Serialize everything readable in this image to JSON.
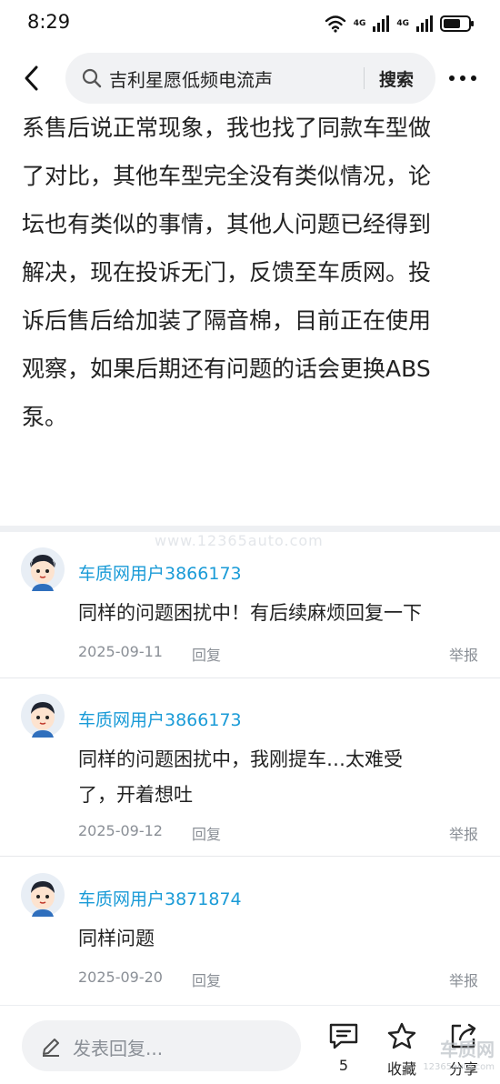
{
  "status_bar": {
    "time": "8:29",
    "net1": "4G",
    "net2": "4G"
  },
  "search": {
    "query": "吉利星愿低频电流声",
    "button": "搜索"
  },
  "article": {
    "lines": [
      "系售后说正常现象，我也找了同款车型做",
      "了对比，其他车型完全没有类似情况，论",
      "坛也有类似的事情，其他人问题已经得到",
      "解决，现在投诉无门，反馈至车质网。投",
      "诉后售后给加装了隔音棉，目前正在使用",
      "观察，如果后期还有问题的话会更换ABS",
      "泵。"
    ]
  },
  "watermark": "www.12365auto.com",
  "comments": [
    {
      "user": "车质网用户3866173",
      "text_lines": [
        "同样的问题困扰中！有后续麻烦回复一下"
      ],
      "date": "2025-09-11",
      "reply": "回复",
      "report": "举报"
    },
    {
      "user": "车质网用户3866173",
      "text_lines": [
        "同样的问题困扰中，我刚提车…太难受",
        "了，开着想吐"
      ],
      "date": "2025-09-12",
      "reply": "回复",
      "report": "举报"
    },
    {
      "user": "车质网用户3871874",
      "text_lines": [
        "同样问题"
      ],
      "date": "2025-09-20",
      "reply": "回复",
      "report": "举报"
    }
  ],
  "bottom_bar": {
    "reply_placeholder": "发表回复...",
    "comment_count": "5",
    "favorite_label": "收藏",
    "share_label": "分享"
  },
  "corner_watermark": {
    "brand": "车质网",
    "site": "12365auto.com"
  },
  "icons": [
    "wifi-icon",
    "signal-icon",
    "battery-icon",
    "back-icon",
    "search-icon",
    "more-icon",
    "avatar-icon",
    "edit-icon",
    "comment-icon",
    "star-icon",
    "share-icon"
  ]
}
